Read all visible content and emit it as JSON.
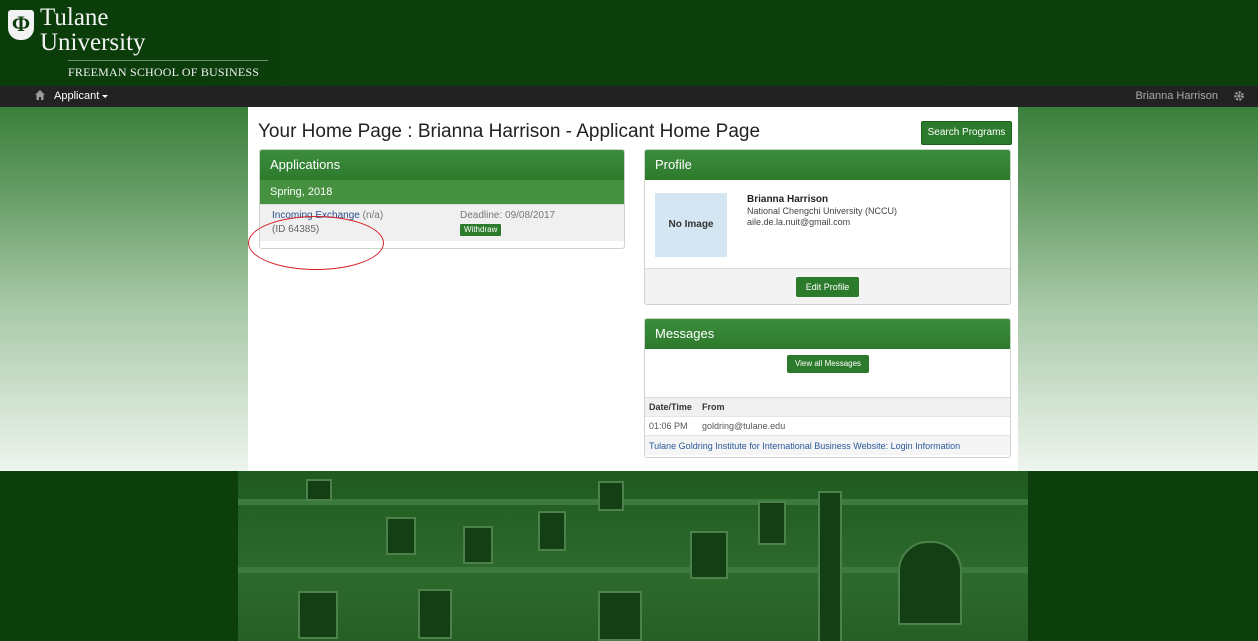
{
  "brand": {
    "shield_glyph": "Φ",
    "line1": "Tulane",
    "line2": "University",
    "school": "FREEMAN SCHOOL OF BUSINESS"
  },
  "nav": {
    "menu_label": "Applicant",
    "user_name": "Brianna Harrison",
    "icons": [
      "home-icon",
      "caret-down-icon",
      "gear-icon"
    ]
  },
  "page": {
    "title": "Your Home Page : Brianna Harrison - Applicant Home Page",
    "search_button": "Search Programs"
  },
  "applications": {
    "heading": "Applications",
    "term": "Spring, 2018",
    "items": [
      {
        "program": "Incoming Exchange",
        "status": "(n/a)",
        "id_text": "(ID 64385)",
        "deadline": "Deadline: 09/08/2017",
        "withdraw_label": "Withdraw"
      }
    ]
  },
  "profile": {
    "heading": "Profile",
    "image_placeholder": "No Image",
    "name": "Brianna Harrison",
    "school": "National Chengchi University (NCCU)",
    "email": "aile.de.la.nuit@gmail.com",
    "edit_button": "Edit Profile"
  },
  "messages": {
    "heading": "Messages",
    "view_all_button": "View all Messages",
    "columns": [
      "Date/Time",
      "From"
    ],
    "rows": [
      {
        "time": "01:06 PM",
        "from": "goldring@tulane.edu"
      }
    ],
    "subject": "Tulane Goldring Institute for International Business Website: Login Information"
  },
  "colors": {
    "header_green": "#0b3d0b",
    "panel_green": "#2d7a2d",
    "navbar": "#222222",
    "link_blue": "#2a4d8a",
    "annotation_red": "#d81f26"
  }
}
